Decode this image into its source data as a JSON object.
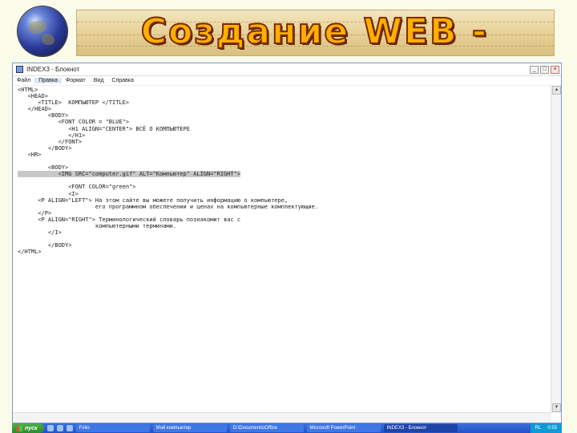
{
  "slide": {
    "title": "Создание WEB - сайта",
    "colors": {
      "title_fill": "#ffb000",
      "title_outline": "#7a2a00",
      "background": "#fbfbe9"
    },
    "logo_icon": "globe-icon"
  },
  "window": {
    "title": "INDEX3 - Блокнот",
    "buttons": [
      "_",
      "□",
      "×"
    ],
    "menu": [
      "Файл",
      "Правка",
      "Формат",
      "Вид",
      "Справка"
    ]
  },
  "editor": {
    "lines": [
      "<HTML>",
      "   <HEAD>",
      "      <TITLE>  КОМПЬЮТЕР </TITLE>",
      "   </HEAD>",
      "         <BODY>",
      "            <FONT COLOR = \"BLUE\">",
      "               <H1 ALIGN=\"CENTER\"> ВСЁ О КОМПЬЮТЕРЕ",
      "               </H1>",
      "            </FONT>",
      "         </BODY>",
      "   <HR>",
      "",
      "         <BODY>",
      "            <IMG SRC=\"computer.gif\" ALT=\"Компьютер\" ALIGN=\"RIGHT\">",
      "",
      "               <FONT COLOR=\"green\">",
      "               <I>",
      "      <P ALIGN=\"LEFT\"> На этом сайте вы можете получить информацию о компьютере,",
      "                       его программном обеспечении и ценах на компьютерные комплектующие.",
      "      </P>",
      "      <P ALIGN=\"RIGHT\"> Терминологический словарь познакомит вас с",
      "                       компьютерными терминами.",
      "         </I>",
      "",
      "         </BODY>",
      "</HTML>"
    ],
    "selected_line_index": 13
  },
  "taskbar": {
    "start_label": "пуск",
    "tasks": [
      {
        "label": "Folio",
        "active": false
      },
      {
        "label": "Мой компьютер",
        "active": false
      },
      {
        "label": "D:\\Documents\\Office",
        "active": false
      },
      {
        "label": "Microsoft PowerPoint",
        "active": false
      },
      {
        "label": "INDEX3 - Блокнот",
        "active": true
      }
    ],
    "language": "RL",
    "clock": "0:55"
  }
}
